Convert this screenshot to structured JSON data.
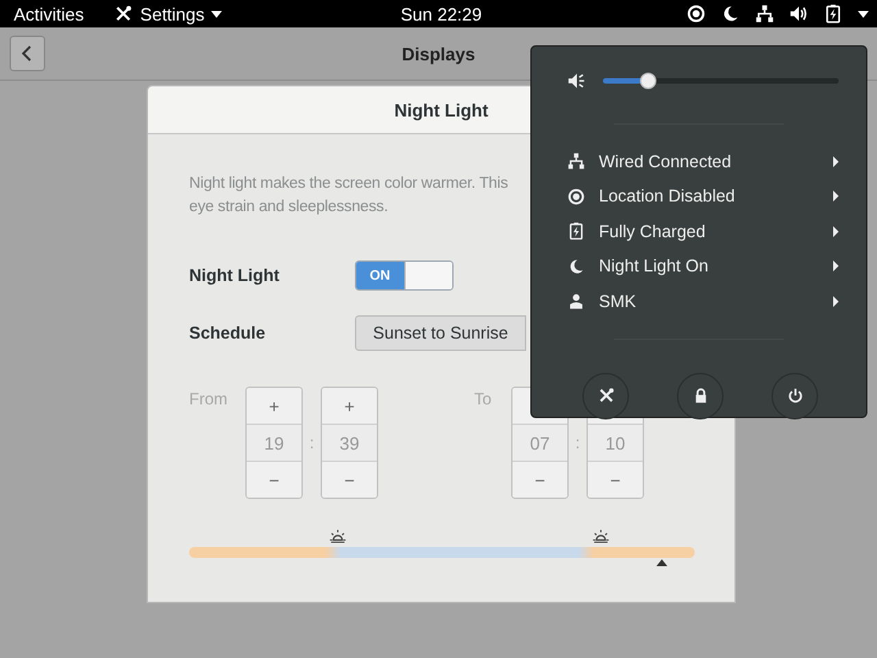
{
  "top_bar": {
    "activities": "Activities",
    "app_menu": "Settings",
    "clock": "Sun 22:29"
  },
  "header_bar": {
    "title": "Displays"
  },
  "dialog": {
    "title": "Night Light",
    "description_lines": [
      "Night light makes the screen color warmer. This",
      "eye strain and sleeplessness."
    ],
    "night_light": {
      "label": "Night Light",
      "on": true,
      "on_text": "ON"
    },
    "schedule": {
      "label": "Schedule",
      "value": "Sunset to Sunrise"
    },
    "from": {
      "label": "From",
      "separator": ":",
      "hours": {
        "plus": "+",
        "value": "19",
        "minus": "−"
      },
      "minutes": {
        "plus": "+",
        "value": "39",
        "minus": "−"
      }
    },
    "to": {
      "label": "To",
      "separator": ":",
      "hours": {
        "value": "07",
        "minus": "−"
      },
      "minutes": {
        "value": "10",
        "minus": "−"
      }
    }
  },
  "system_menu": {
    "volume": {
      "level": 0.19
    },
    "items": [
      {
        "label": "Wired Connected"
      },
      {
        "label": "Location Disabled"
      },
      {
        "label": "Fully Charged"
      },
      {
        "label": "Night Light On"
      },
      {
        "label": "SMK"
      }
    ]
  }
}
